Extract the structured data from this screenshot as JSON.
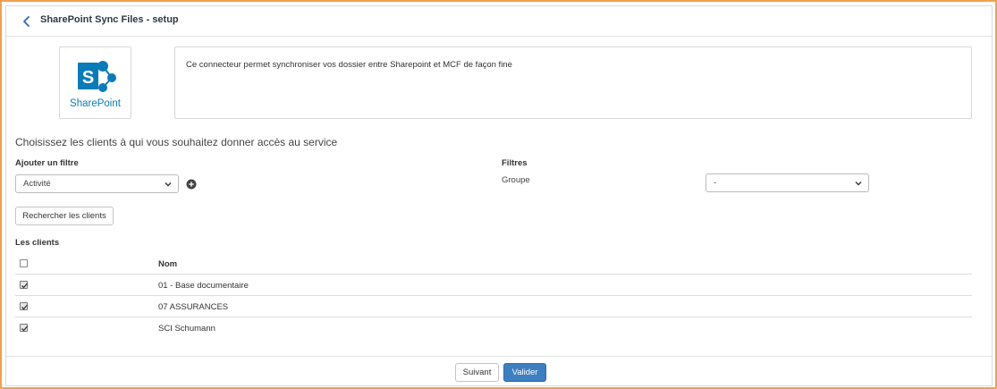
{
  "header": {
    "title": "SharePoint Sync Files - setup",
    "back_icon": "chevron-left-icon"
  },
  "connector": {
    "logo_text": "SharePoint",
    "logo_color": "#0b7bb8",
    "description": "Ce connecteur permet synchroniser vos dossier entre Sharepoint et MCF de façon fine"
  },
  "clients_section": {
    "title": "Choisissez les clients à qui vous souhaitez donner accès au service",
    "add_filter_label": "Ajouter un filtre",
    "filter_select_value": "Activité",
    "add_filter_icon": "plus-circle-icon",
    "filters_label": "Filtres",
    "group_label": "Groupe",
    "group_select_value": "-",
    "search_button": "Rechercher les clients"
  },
  "table": {
    "title": "Les clients",
    "header_name": "Nom",
    "rows": [
      {
        "name": "01 - Base documentaire",
        "checked": true
      },
      {
        "name": "07 ASSURANCES",
        "checked": true
      },
      {
        "name": "SCI Schumann",
        "checked": true
      }
    ]
  },
  "footer": {
    "next_button": "Suivant",
    "validate_button": "Valider",
    "primary_color": "#3d7fc1"
  }
}
